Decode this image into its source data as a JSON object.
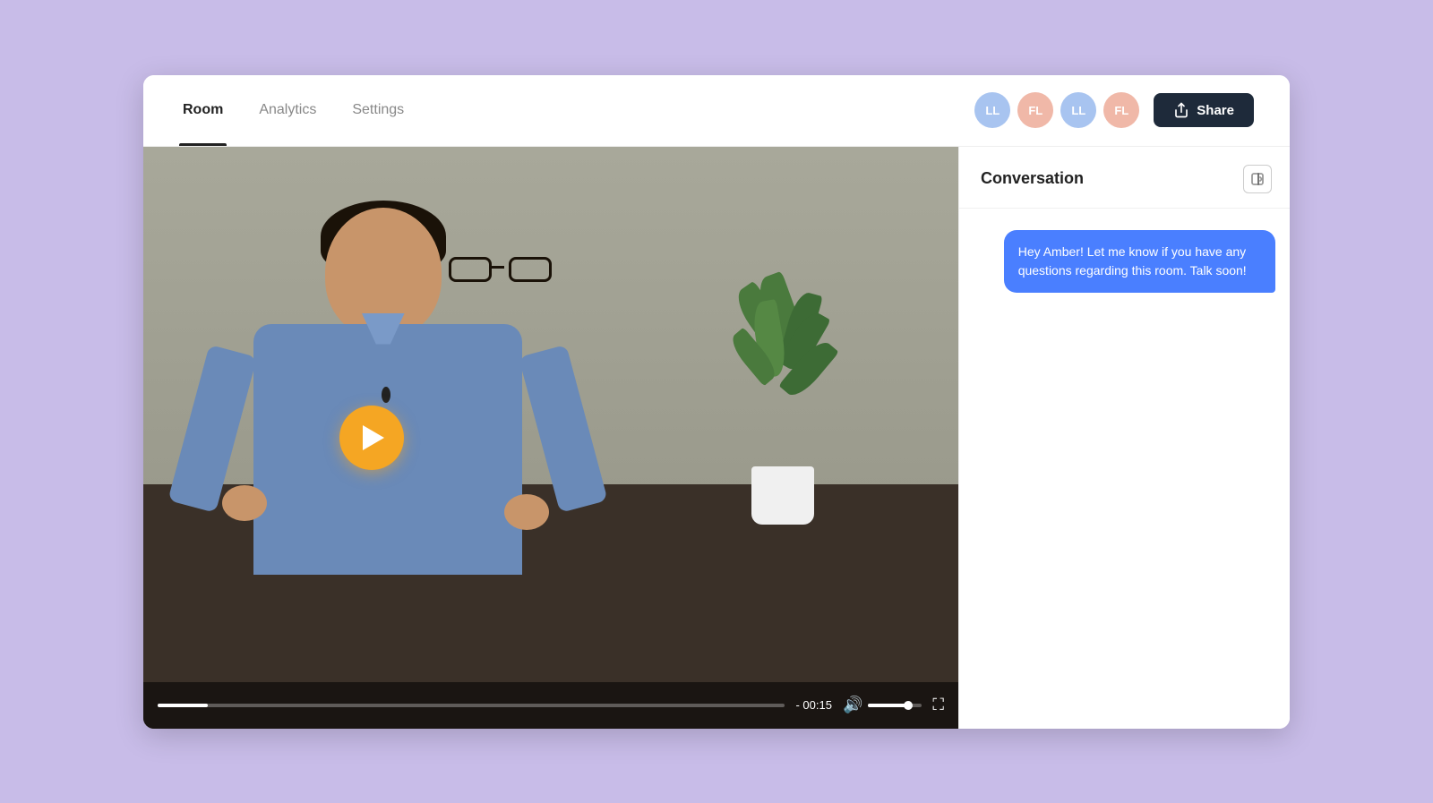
{
  "header": {
    "tabs": [
      {
        "id": "room",
        "label": "Room",
        "active": true
      },
      {
        "id": "analytics",
        "label": "Analytics",
        "active": false
      },
      {
        "id": "settings",
        "label": "Settings",
        "active": false
      }
    ],
    "avatars": [
      {
        "id": "ll1",
        "initials": "LL",
        "color": "#a8c4f0"
      },
      {
        "id": "fl1",
        "initials": "FL",
        "color": "#f0b8a8"
      },
      {
        "id": "ll2",
        "initials": "LL",
        "color": "#a8c4f0"
      },
      {
        "id": "fl2",
        "initials": "FL",
        "color": "#f0b8a8"
      }
    ],
    "share_button": "Share"
  },
  "video": {
    "time_remaining": "- 00:15",
    "play_label": "Play",
    "progress_percent": 8,
    "volume_percent": 75
  },
  "conversation": {
    "title": "Conversation",
    "collapse_icon": "collapse-panel",
    "message": "Hey Amber! Let me know if you have any questions regarding this room. Talk soon!"
  }
}
